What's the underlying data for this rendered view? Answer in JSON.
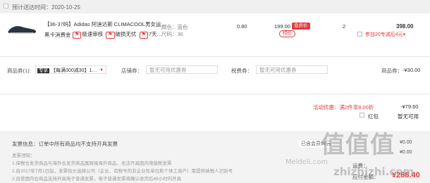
{
  "delivery": {
    "label": "预计送达时间：2020-10-25"
  },
  "product": {
    "title": "【36-37码】Adidas 阿迪达斯 CLIMACOOL男女运…",
    "subtitle": "黑卡消费金",
    "tags": [
      "极速审核",
      "破损无忧",
      "7天…"
    ],
    "color": "颜色：蓝色",
    "size": "尺码：36",
    "rate": "0.80",
    "price": "199.00",
    "member_badge": "会员价",
    "special_badge": "特价",
    "qty": "2",
    "total": "398.00",
    "promo_link": "参加20专减后4元",
    "promo_arrow": "▾"
  },
  "coupons": {
    "product_label": "商品券(1):",
    "product_tag": "专享",
    "product_value": "【每满300减30】1…",
    "shop_label": "店铺券：",
    "shop_placeholder": "暂无可用优惠券",
    "tax_label": "税费券：",
    "tax_placeholder": "暂无可用优惠券",
    "discount_label": "商品券：",
    "discount_value": "-¥30.00"
  },
  "summary": {
    "activity_label": "活动优惠：满2件享8.00折",
    "activity_value": "-¥79.60",
    "redpack_label": "红包",
    "redpack_value": "暂无可用"
  },
  "invoice": {
    "label": "发票信息：",
    "value": "订单中所有商品均不支持开具发票",
    "notes_title": "发票须知：",
    "notes": [
      "1.保税仓发货商品与海外仓发货商品属跨境海外商品，无法开具国内增值税发票",
      "2.自2017年7月1日起，发票抬头选择公司（企业、有税号的非企业性单位和个体工商户）需提供纳税人识别号",
      "3.自营国内仓商品支持开具电子普通发票，电子普通发票将确认收货后48小时内开具"
    ]
  },
  "member": {
    "saved_label": "已含会员98元",
    "amount_label": "运费：",
    "total_label": "应付金额：",
    "total_value": "¥288.40",
    "amount_small_1": "¥0.00",
    "amount_small_2": "¥0.00"
  },
  "watermark": {
    "logo": "值值值",
    "site": "Meldeli.com",
    "site2": "zhizhizhi.com"
  }
}
